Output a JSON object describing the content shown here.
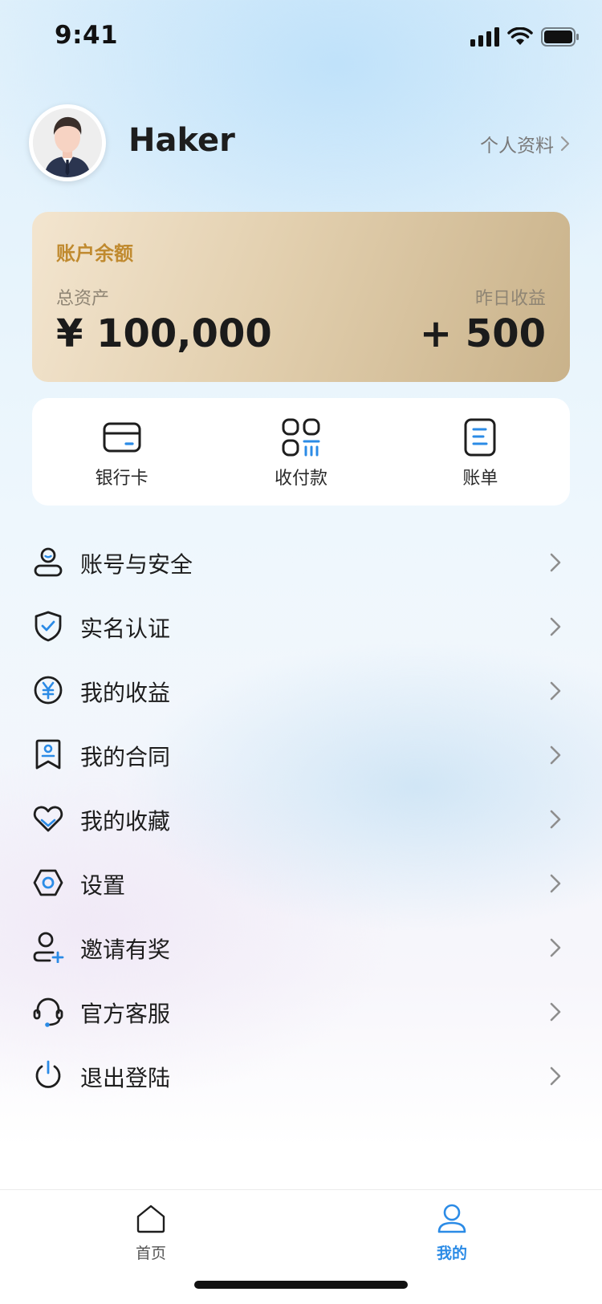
{
  "status_bar": {
    "time": "9:41"
  },
  "header": {
    "username": "Haker",
    "profile_link": "个人资料"
  },
  "balance_card": {
    "title": "账户余额",
    "total_label": "总资产",
    "total_value": "¥ 100,000",
    "yesterday_label": "昨日收益",
    "yesterday_value": "+ 500",
    "accent_color": "#c08a2f"
  },
  "quick_actions": [
    {
      "label": "银行卡",
      "icon": "bank-card-icon"
    },
    {
      "label": "收付款",
      "icon": "payment-icon"
    },
    {
      "label": "账单",
      "icon": "bill-icon"
    }
  ],
  "menu": [
    {
      "label": "账号与安全",
      "icon": "account-security-icon"
    },
    {
      "label": "实名认证",
      "icon": "verified-shield-icon"
    },
    {
      "label": "我的收益",
      "icon": "yuan-coin-icon"
    },
    {
      "label": "我的合同",
      "icon": "contract-icon"
    },
    {
      "label": "我的收藏",
      "icon": "heart-icon"
    },
    {
      "label": "设置",
      "icon": "settings-hexagon-icon"
    },
    {
      "label": "邀请有奖",
      "icon": "invite-user-icon"
    },
    {
      "label": "官方客服",
      "icon": "headset-icon"
    },
    {
      "label": "退出登陆",
      "icon": "power-icon"
    }
  ],
  "tab_bar": {
    "tabs": [
      {
        "label": "首页",
        "icon": "home-icon",
        "active": false
      },
      {
        "label": "我的",
        "icon": "user-icon",
        "active": true
      }
    ],
    "active_color": "#2b8be6"
  }
}
